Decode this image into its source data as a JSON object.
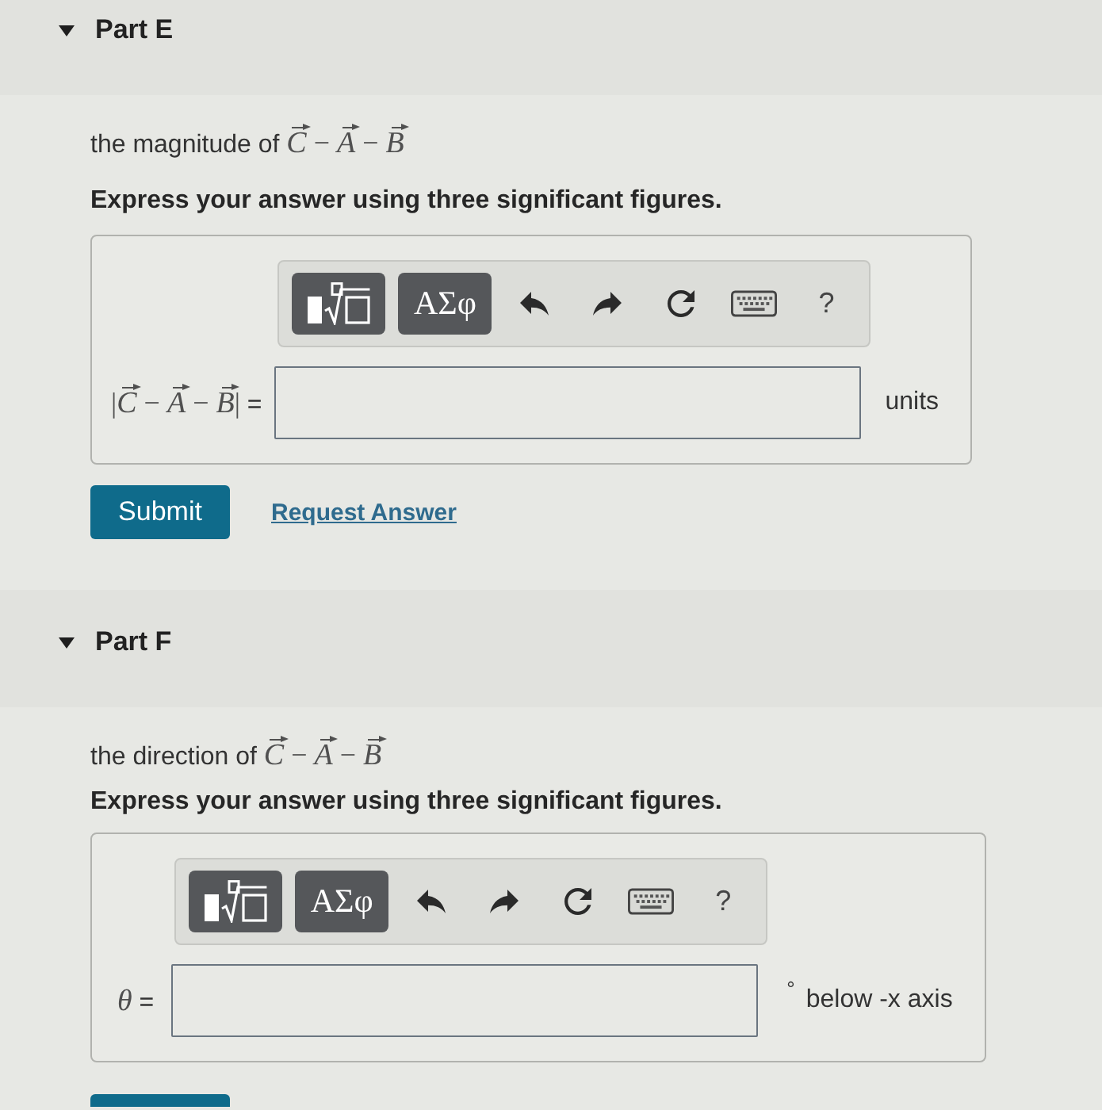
{
  "parts": [
    {
      "title": "Part E",
      "expanded": true,
      "prompt": [
        {
          "kind": "text",
          "text": "the magnitude of "
        },
        {
          "kind": "vector",
          "text": "C"
        },
        {
          "kind": "math",
          "text": " − "
        },
        {
          "kind": "vector",
          "text": "A"
        },
        {
          "kind": "math",
          "text": " − "
        },
        {
          "kind": "vector",
          "text": "B"
        }
      ],
      "instruction": "Express your answer using three significant figures.",
      "toolbar": [
        {
          "kind": "templates"
        },
        {
          "kind": "symbols",
          "label": "ΑΣφ"
        },
        {
          "kind": "undo"
        },
        {
          "kind": "redo"
        },
        {
          "kind": "reset"
        },
        {
          "kind": "keyboard"
        },
        {
          "kind": "help",
          "label": "?"
        }
      ],
      "answer": {
        "label": [
          {
            "kind": "math",
            "text": "|"
          },
          {
            "kind": "vector",
            "text": "C"
          },
          {
            "kind": "math",
            "text": " − "
          },
          {
            "kind": "vector",
            "text": "A"
          },
          {
            "kind": "math",
            "text": " − "
          },
          {
            "kind": "vector",
            "text": "B"
          },
          {
            "kind": "math",
            "text": "|"
          },
          {
            "kind": "text",
            "text": " ="
          }
        ],
        "suffix": "units"
      },
      "submit": {
        "label": "Submit",
        "cut_off": false
      },
      "request_answer": "Request Answer"
    },
    {
      "title": "Part F",
      "expanded": true,
      "prompt": [
        {
          "kind": "text",
          "text": "the direction of "
        },
        {
          "kind": "vector",
          "text": "C"
        },
        {
          "kind": "math",
          "text": " − "
        },
        {
          "kind": "vector",
          "text": "A"
        },
        {
          "kind": "math",
          "text": " − "
        },
        {
          "kind": "vector",
          "text": "B"
        }
      ],
      "instruction": "Express your answer using three significant figures.",
      "toolbar": [
        {
          "kind": "templates"
        },
        {
          "kind": "symbols",
          "label": "ΑΣφ"
        },
        {
          "kind": "undo"
        },
        {
          "kind": "redo"
        },
        {
          "kind": "reset"
        },
        {
          "kind": "keyboard"
        },
        {
          "kind": "help",
          "label": "?"
        }
      ],
      "answer": {
        "label": [
          {
            "kind": "variable",
            "text": "θ"
          },
          {
            "kind": "text",
            "text": " ="
          }
        ],
        "unit_mark": "°",
        "suffix": "below -x axis"
      },
      "submit": {
        "cut_off": true
      }
    }
  ]
}
